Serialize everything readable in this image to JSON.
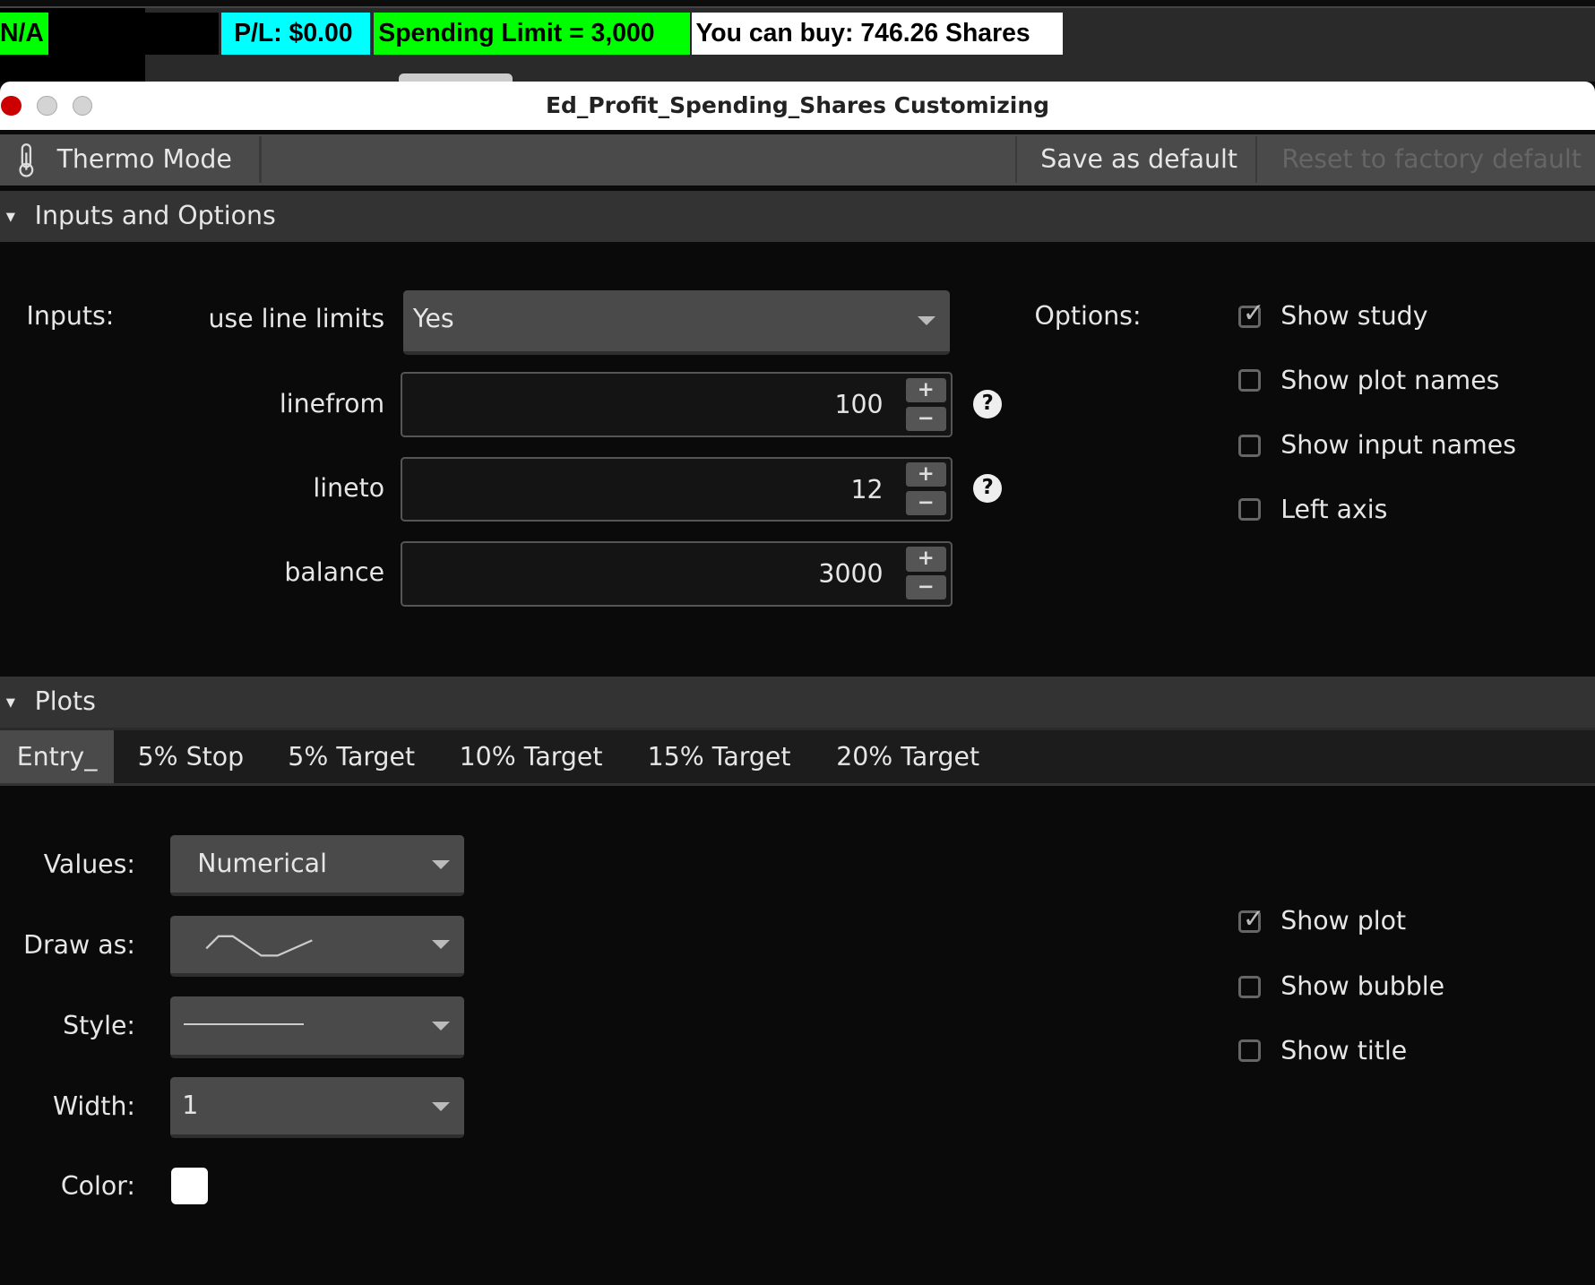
{
  "top_badges": {
    "na": "N/A",
    "pl": "P/L: $0.00",
    "spending": "Spending Limit = 3,000",
    "buy": "You can buy: 746.26 Shares"
  },
  "colors": {
    "na": "#00ff00",
    "pl": "#00ffff",
    "spending": "#00ff00",
    "buy": "#ffffff",
    "close": "#cc0000"
  },
  "window": {
    "title": "Ed_Profit_Spending_Shares Customizing"
  },
  "toolbar": {
    "thermo": "Thermo Mode",
    "save": "Save as default",
    "reset": "Reset to factory default"
  },
  "inputs_section": {
    "title": "Inputs and Options",
    "inputs_label": "Inputs:",
    "options_label": "Options:",
    "use_line_limits": {
      "label": "use line limits",
      "value": "Yes"
    },
    "linefrom": {
      "label": "linefrom",
      "value": "100"
    },
    "lineto": {
      "label": "lineto",
      "value": "12"
    },
    "balance": {
      "label": "balance",
      "value": "3000"
    },
    "options": [
      {
        "label": "Show study",
        "checked": true
      },
      {
        "label": "Show plot names",
        "checked": false
      },
      {
        "label": "Show input names",
        "checked": false
      },
      {
        "label": "Left axis",
        "checked": false
      }
    ]
  },
  "plots_section": {
    "title": "Plots",
    "tabs": [
      "Entry_",
      "5% Stop",
      "5% Target",
      "10% Target",
      "15% Target",
      "20% Target"
    ],
    "active_tab": "Entry_",
    "values_label": "Values:",
    "values": "Numerical",
    "draw_as_label": "Draw as:",
    "style_label": "Style:",
    "width_label": "Width:",
    "width": "1",
    "color_label": "Color:",
    "color": "#ffffff",
    "options": [
      {
        "label": "Show plot",
        "checked": true
      },
      {
        "label": "Show bubble",
        "checked": false
      },
      {
        "label": "Show title",
        "checked": false
      }
    ]
  }
}
